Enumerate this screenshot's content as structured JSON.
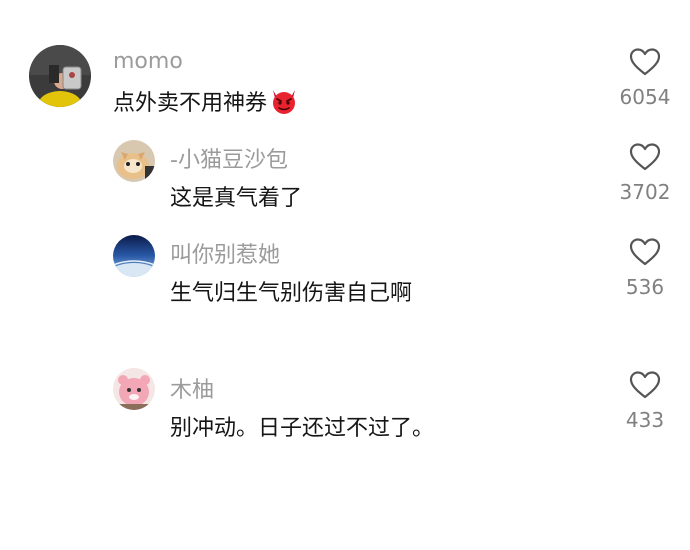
{
  "comments": [
    {
      "username": "momo",
      "text": "点外卖不用神券",
      "emoji": "devil-emoji",
      "likes": "6054",
      "avatar": "user-photo-avatar"
    },
    {
      "username": "-小猫豆沙包",
      "text": "这是真气着了",
      "likes": "3702",
      "avatar": "cat-avatar"
    },
    {
      "username": "叫你别惹她",
      "text": "生气归生气别伤害自己啊",
      "likes": "536",
      "avatar": "earth-horizon-avatar"
    },
    {
      "username": "木柚",
      "text": "别冲动。日子还过不过了。",
      "likes": "433",
      "avatar": "pink-plush-avatar"
    }
  ],
  "icons": {
    "like": "heart-outline-icon"
  },
  "colors": {
    "username": "#9b9b9b",
    "text": "#161616",
    "count": "#808080",
    "heart_stroke": "#555555"
  }
}
